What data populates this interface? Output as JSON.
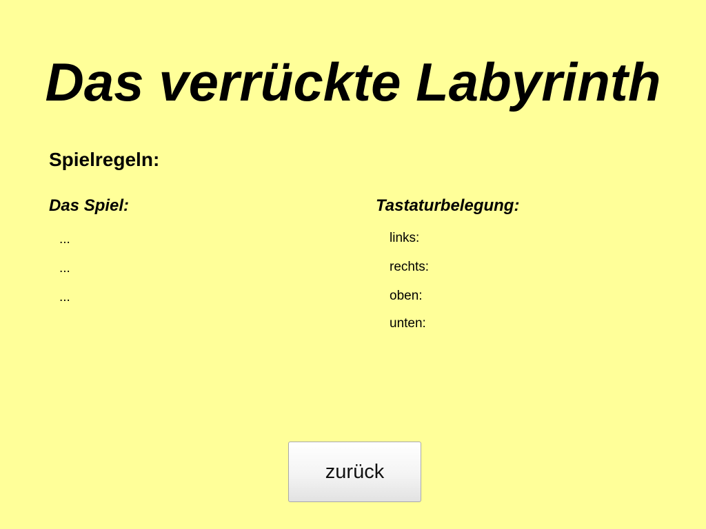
{
  "page": {
    "title": "Das verrückte Labyrinth",
    "background_color": "#ffff99"
  },
  "rules": {
    "heading": "Spielregeln:",
    "game": {
      "heading": "Das Spiel:",
      "lines": [
        "...",
        "...",
        "..."
      ]
    },
    "keyboard": {
      "heading": "Tastaturbelegung:",
      "keys": [
        {
          "label": "links:"
        },
        {
          "label": "rechts:"
        },
        {
          "label": "oben:"
        },
        {
          "label": "unten:"
        }
      ]
    }
  },
  "actions": {
    "back_label": "zurück"
  }
}
